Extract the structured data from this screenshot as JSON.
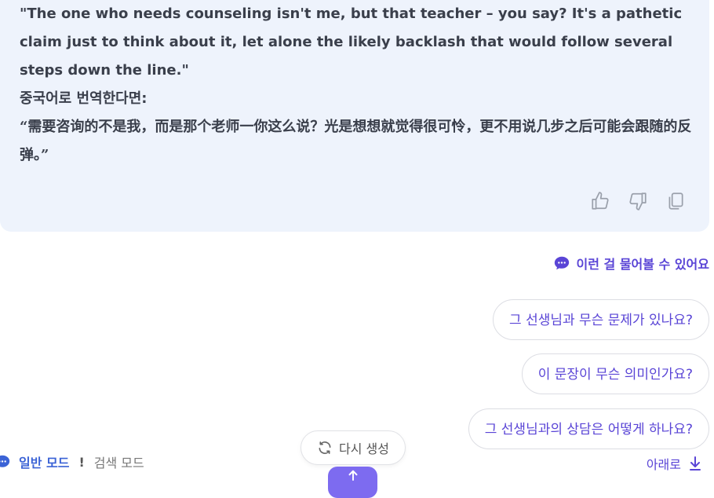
{
  "answer": {
    "lines": [
      "\"The one who needs counseling isn't me, but that teacher – you say? It's a pathetic claim just to think about it, let alone the likely backlash that would follow several steps down the line.\"",
      "중국어로 번역한다면:",
      "“需要咨询的不是我，而是那个老师一你这么说？光是想想就觉得很可怜，更不用说几步之后可能会跟随的反弹。”"
    ]
  },
  "suggestions": {
    "header": "이런 걸 물어볼 수 있어요",
    "items": [
      "그 선생님과 무슨 문제가 있나요?",
      "이 문장이 무슨 의미인가요?",
      "그 선생님과의 상담은 어떻게 하나요?"
    ]
  },
  "modes": {
    "general": "일반 모드",
    "separator": "!",
    "search": "검색 모드"
  },
  "regenerate_label": "다시 생성",
  "scroll_down_label": "아래로",
  "colors": {
    "accent": "#5a45d6",
    "card_bg": "#eef3fc",
    "mode_blue": "#3b63d6",
    "send_button": "#7d6bf0"
  },
  "icons": {
    "like": "thumbs-up-icon",
    "dislike": "thumbs-down-icon",
    "copy": "copy-icon",
    "suggest": "chat-bubble-icon",
    "regenerate": "refresh-icon",
    "scroll": "arrow-down-icon",
    "send": "arrow-up-icon"
  }
}
